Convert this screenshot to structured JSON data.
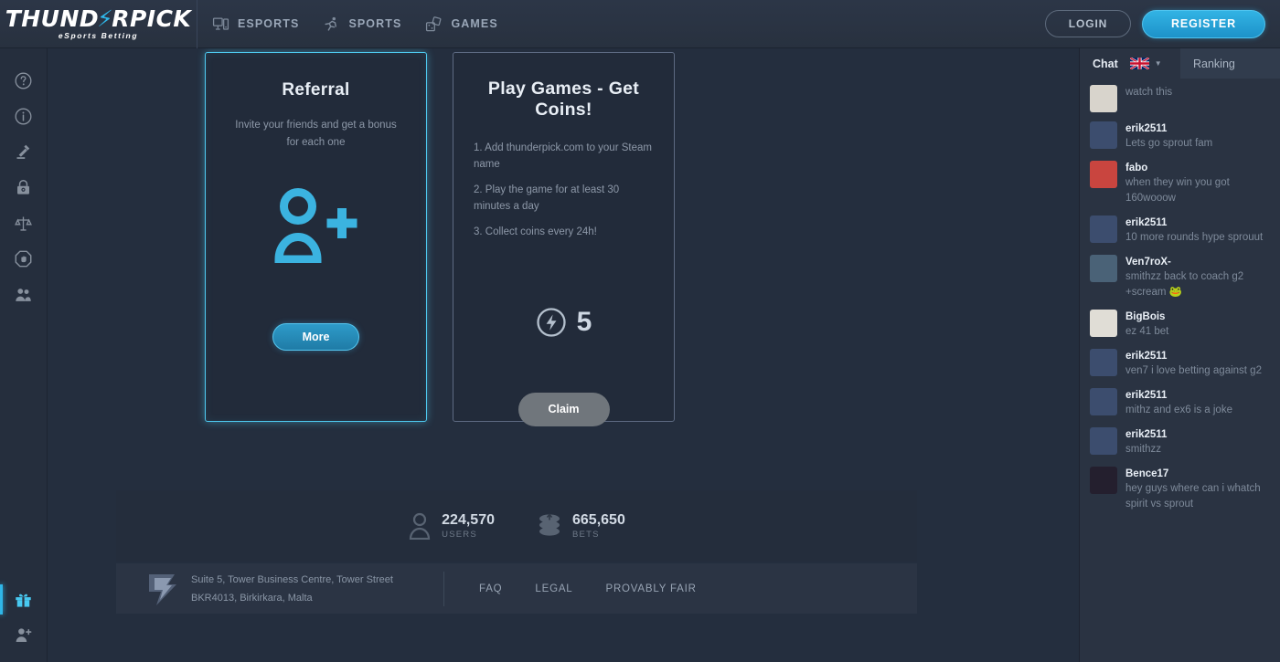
{
  "brand": {
    "name_part1": "THUND",
    "name_bolt": "⚡",
    "name_part2": "RPICK",
    "tagline": "eSports Betting"
  },
  "nav": {
    "items": [
      {
        "label": "ESPORTS",
        "icon": "monitor-icon"
      },
      {
        "label": "SPORTS",
        "icon": "runner-icon"
      },
      {
        "label": "GAMES",
        "icon": "dice-icon"
      }
    ],
    "login_label": "LOGIN",
    "register_label": "REGISTER"
  },
  "sidebar": {
    "items": [
      {
        "name": "help",
        "icon": "question-circle-icon"
      },
      {
        "name": "about",
        "icon": "info-circle-icon"
      },
      {
        "name": "legal",
        "icon": "gavel-icon"
      },
      {
        "name": "security",
        "icon": "lock-icon"
      },
      {
        "name": "fairness",
        "icon": "scales-icon"
      },
      {
        "name": "responsible-gaming",
        "icon": "stop-hand-icon"
      },
      {
        "name": "affiliates",
        "icon": "people-icon"
      }
    ],
    "bottom_items": [
      {
        "name": "bonus",
        "icon": "gift-icon",
        "active": true
      },
      {
        "name": "referral",
        "icon": "user-plus-icon",
        "active": false
      }
    ]
  },
  "cards": {
    "referral": {
      "title": "Referral",
      "description": "Invite your friends and get a bonus for each one",
      "icon": "user-plus-icon",
      "button_label": "More",
      "accent_color": "#4ec9f0"
    },
    "games": {
      "title": "Play Games - Get Coins!",
      "steps": [
        "1. Add thunderpick.com to your Steam name",
        "2. Play the game for at least 30 minutes a day",
        "3. Collect coins every 24h!"
      ],
      "coin_icon": "thunder-coin-icon",
      "coin_amount": "5",
      "button_label": "Claim"
    }
  },
  "stats": [
    {
      "icon": "user-icon",
      "value": "224,570",
      "caption": "USERS"
    },
    {
      "icon": "coins-stack-icon",
      "value": "665,650",
      "caption": "BETS"
    }
  ],
  "footer": {
    "logo_icon": "thunder-logo-icon",
    "address_line1": "Suite 5, Tower Business Centre, Tower Street",
    "address_line2": "BKR4013, Birkirkara, Malta",
    "links": [
      {
        "label": "FAQ"
      },
      {
        "label": "LEGAL"
      },
      {
        "label": "PROVABLY FAIR"
      }
    ]
  },
  "chat": {
    "tab_chat_label": "Chat",
    "tab_ranking_label": "Ranking",
    "language_flag": "uk-flag-icon",
    "chevron": "chevron-down-icon",
    "messages": [
      {
        "user": "",
        "text": "watch this",
        "avatar_color": "#d8d4cc",
        "partial": true
      },
      {
        "user": "erik2511",
        "text": "Lets go sprout fam",
        "avatar_color": "#3c4d6e"
      },
      {
        "user": "fabo",
        "text": "when they win you got 160wooow",
        "avatar_color": "#c9453f"
      },
      {
        "user": "erik2511",
        "text": "10 more rounds hype sprouut",
        "avatar_color": "#3c4d6e"
      },
      {
        "user": "Ven7roX-",
        "text": "smithzz back to coach g2 +scream 🐸",
        "avatar_color": "#4a6277"
      },
      {
        "user": "BigBois",
        "text": "ez 41 bet",
        "avatar_color": "#e0ddd6"
      },
      {
        "user": "erik2511",
        "text": "ven7 i love  betting against g2",
        "avatar_color": "#3c4d6e"
      },
      {
        "user": "erik2511",
        "text": "mithz and ex6 is a joke",
        "avatar_color": "#3c4d6e"
      },
      {
        "user": "erik2511",
        "text": "smithzz",
        "avatar_color": "#3c4d6e"
      },
      {
        "user": "Bence17",
        "text": "hey guys where can i whatch spirit vs sprout",
        "avatar_color": "#241f2e"
      }
    ]
  }
}
